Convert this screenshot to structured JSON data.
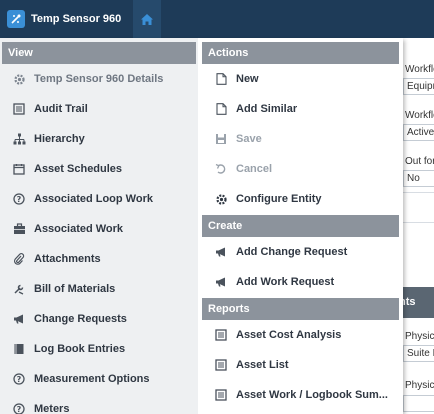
{
  "app": {
    "title": "Temp Sensor 960"
  },
  "background": {
    "labels": [
      "Workflo",
      "Workflo",
      "Out for",
      "Physica",
      "Physica"
    ],
    "fields": [
      "Equipm",
      "Active",
      "No",
      "Suite F",
      ""
    ],
    "tab": "nts"
  },
  "menu": {
    "view": {
      "header": "View",
      "items": [
        {
          "label": "Temp Sensor 960 Details",
          "icon": "gear-icon"
        },
        {
          "label": "Audit Trail",
          "icon": "list-icon"
        },
        {
          "label": "Hierarchy",
          "icon": "hierarchy-icon"
        },
        {
          "label": "Asset Schedules",
          "icon": "calendar-icon"
        },
        {
          "label": "Associated Loop Work",
          "icon": "question-circle-icon"
        },
        {
          "label": "Associated Work",
          "icon": "briefcase-icon"
        },
        {
          "label": "Attachments",
          "icon": "paperclip-icon"
        },
        {
          "label": "Bill of Materials",
          "icon": "tools-icon"
        },
        {
          "label": "Change Requests",
          "icon": "megaphone-icon"
        },
        {
          "label": "Log Book Entries",
          "icon": "book-icon"
        },
        {
          "label": "Measurement Options",
          "icon": "question-circle-icon"
        },
        {
          "label": "Meters",
          "icon": "question-circle-icon"
        }
      ]
    },
    "actions": {
      "header": "Actions",
      "items": [
        {
          "label": "New",
          "icon": "new-document-icon"
        },
        {
          "label": "Add Similar",
          "icon": "copy-document-icon"
        },
        {
          "label": "Save",
          "icon": "save-icon"
        },
        {
          "label": "Cancel",
          "icon": "undo-icon"
        },
        {
          "label": "Configure Entity",
          "icon": "gear-icon"
        }
      ]
    },
    "create": {
      "header": "Create",
      "items": [
        {
          "label": "Add Change Request",
          "icon": "megaphone-icon"
        },
        {
          "label": "Add Work Request",
          "icon": "megaphone-icon"
        }
      ]
    },
    "reports": {
      "header": "Reports",
      "items": [
        {
          "label": "Asset Cost Analysis",
          "icon": "report-icon"
        },
        {
          "label": "Asset List",
          "icon": "report-icon"
        },
        {
          "label": "Asset Work / Logbook Sum...",
          "icon": "report-icon"
        }
      ]
    }
  },
  "colors": {
    "topbar": "#1e3b58",
    "section_header": "#8c939c",
    "accent": "#3a8fd6"
  }
}
